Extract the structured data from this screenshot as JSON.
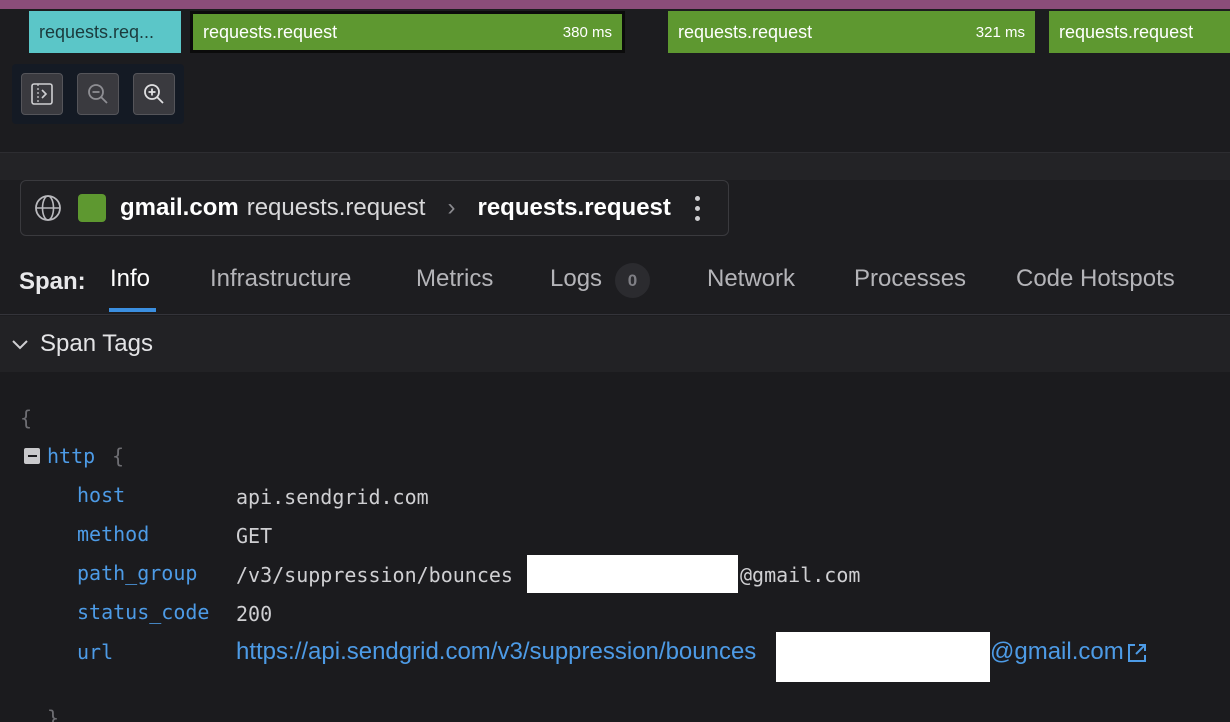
{
  "flame": {
    "bars": [
      {
        "label": "requests.req...",
        "duration": ""
      },
      {
        "label": "requests.request",
        "duration": "380 ms"
      },
      {
        "label": "requests.request",
        "duration": "321 ms"
      },
      {
        "label": "requests.request",
        "duration": ""
      }
    ],
    "colors": {
      "teal": "#5bc6c8",
      "green": "#5e9830",
      "top_strip": "#8b4d7a"
    },
    "tools": [
      "toggle-sidebar-icon",
      "zoom-out-icon",
      "zoom-in-icon"
    ]
  },
  "breadcrumb": {
    "service": "gmail.com",
    "operation": "requests.request",
    "current": "requests.request"
  },
  "tabs": {
    "prefix": "Span:",
    "items": [
      {
        "label": "Info",
        "active": true
      },
      {
        "label": "Infrastructure"
      },
      {
        "label": "Metrics"
      },
      {
        "label": "Logs",
        "badge": "0"
      },
      {
        "label": "Network"
      },
      {
        "label": "Processes"
      },
      {
        "label": "Code Hotspots"
      }
    ]
  },
  "section": {
    "title": "Span Tags"
  },
  "tags": {
    "open_brace": "{",
    "close_brace": "}",
    "group": {
      "key": "http",
      "brace": "{"
    },
    "rows": [
      {
        "key": "host",
        "value": "api.sendgrid.com"
      },
      {
        "key": "method",
        "value": "GET"
      },
      {
        "key": "path_group",
        "value": "/v3/suppression/bounces",
        "value_tail": "@gmail.com"
      },
      {
        "key": "status_code",
        "value": "200"
      },
      {
        "key": "url",
        "value": "https://api.sendgrid.com/v3/suppression/bounces",
        "value_tail": "@gmail.com"
      }
    ]
  }
}
